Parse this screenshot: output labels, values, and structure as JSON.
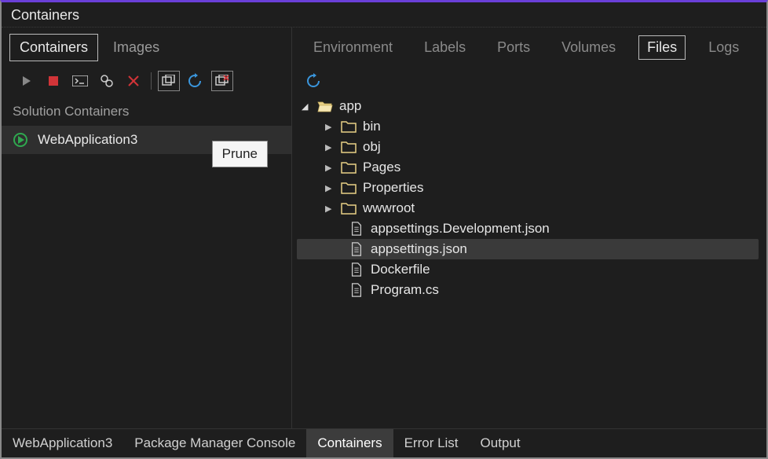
{
  "window_title": "Containers",
  "left_tabs": [
    {
      "label": "Containers",
      "active": true
    },
    {
      "label": "Images",
      "active": false
    }
  ],
  "left_toolbar": {
    "tooltip": "Prune"
  },
  "section_label": "Solution Containers",
  "solution_items": [
    {
      "label": "WebApplication3",
      "running": true
    }
  ],
  "right_tabs": [
    {
      "label": "Environment",
      "active": false
    },
    {
      "label": "Labels",
      "active": false
    },
    {
      "label": "Ports",
      "active": false
    },
    {
      "label": "Volumes",
      "active": false
    },
    {
      "label": "Files",
      "active": true
    },
    {
      "label": "Logs",
      "active": false
    }
  ],
  "tree": {
    "root": {
      "label": "app",
      "expanded": true
    },
    "children": [
      {
        "type": "folder",
        "label": "bin",
        "expanded": false
      },
      {
        "type": "folder",
        "label": "obj",
        "expanded": false
      },
      {
        "type": "folder",
        "label": "Pages",
        "expanded": false
      },
      {
        "type": "folder",
        "label": "Properties",
        "expanded": false
      },
      {
        "type": "folder",
        "label": "wwwroot",
        "expanded": false
      },
      {
        "type": "file",
        "label": "appsettings.Development.json",
        "selected": false
      },
      {
        "type": "file",
        "label": "appsettings.json",
        "selected": true
      },
      {
        "type": "file",
        "label": "Dockerfile",
        "selected": false
      },
      {
        "type": "file",
        "label": "Program.cs",
        "selected": false
      }
    ]
  },
  "bottom_tabs": [
    {
      "label": "WebApplication3",
      "active": false
    },
    {
      "label": "Package Manager Console",
      "active": false
    },
    {
      "label": "Containers",
      "active": true
    },
    {
      "label": "Error List",
      "active": false
    },
    {
      "label": "Output",
      "active": false
    }
  ]
}
